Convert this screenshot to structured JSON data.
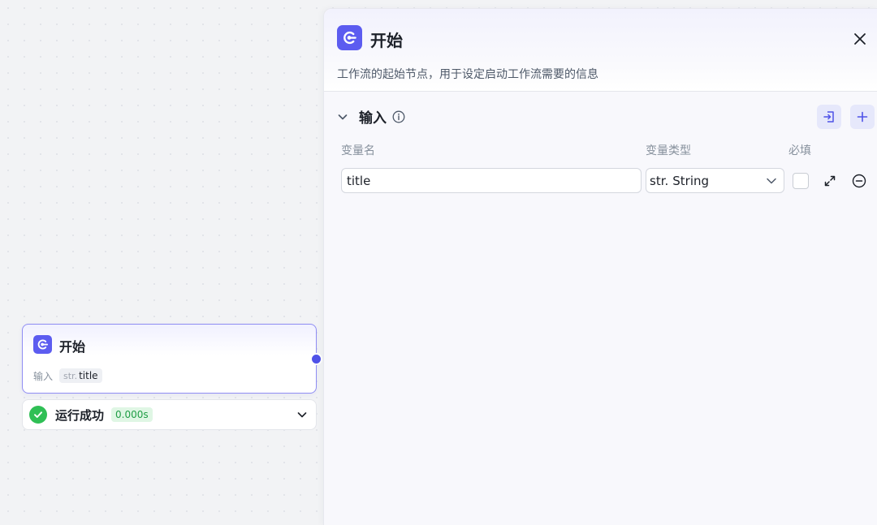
{
  "canvas": {
    "node": {
      "icon": "start-node-icon",
      "title": "开始",
      "input_label": "输入",
      "variable": {
        "type": "str.",
        "name": "title"
      }
    },
    "run_status": {
      "icon": "check-circle-icon",
      "label": "运行成功",
      "duration": "0.000s"
    }
  },
  "panel": {
    "icon": "start-node-icon",
    "title": "开始",
    "description": "工作流的起始节点，用于设定启动工作流需要的信息",
    "section": {
      "title": "输入",
      "columns": {
        "name": "变量名",
        "type": "变量类型",
        "required": "必填"
      },
      "rows": [
        {
          "name": "title",
          "type_prefix": "str.",
          "type": "String",
          "required": false
        }
      ]
    }
  },
  "colors": {
    "accent": "#5c5cf0",
    "handle": "#4f52e8",
    "success": "#2fbf55",
    "success_badge_bg": "#dff6e4",
    "success_badge_text": "#1f9d45"
  }
}
